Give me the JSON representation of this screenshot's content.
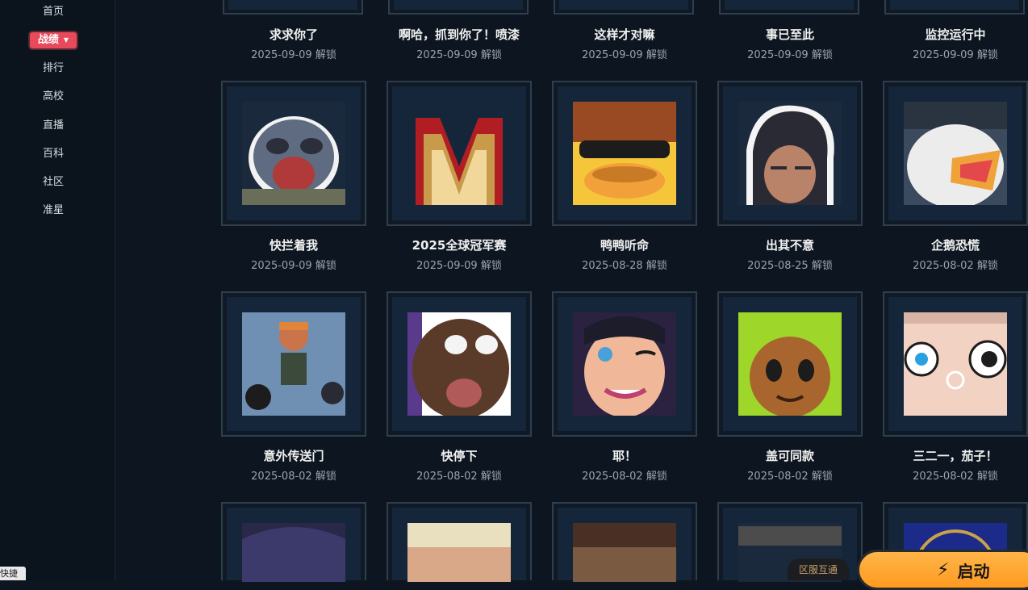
{
  "sidebar": {
    "items": [
      {
        "label": "首页"
      },
      {
        "label": "战绩",
        "active": true
      },
      {
        "label": "排行"
      },
      {
        "label": "高校"
      },
      {
        "label": "直播"
      },
      {
        "label": "百科"
      },
      {
        "label": "社区"
      },
      {
        "label": "准星"
      }
    ],
    "bottom_tag": "快捷"
  },
  "unlock_suffix": "解锁",
  "top_row": [
    {
      "title": "求求你了",
      "date": "2025-09-09 解锁"
    },
    {
      "title": "啊哈，抓到你了！喷漆",
      "date": "2025-09-09 解锁"
    },
    {
      "title": "这样才对嘛",
      "date": "2025-09-09 解锁"
    },
    {
      "title": "事已至此",
      "date": "2025-09-09 解锁"
    },
    {
      "title": "监控运行中",
      "date": "2025-09-09 解锁"
    }
  ],
  "row2": [
    {
      "title": "快拦着我",
      "date": "2025-09-09 解锁",
      "icon": "sloth-icon"
    },
    {
      "title": "2025全球冠军赛",
      "date": "2025-09-09 解锁",
      "icon": "champions-logo-icon"
    },
    {
      "title": "鸭鸭听命",
      "date": "2025-08-28 解锁",
      "icon": "duck-icon"
    },
    {
      "title": "出其不意",
      "date": "2025-08-25 解锁",
      "icon": "agent-portrait-icon"
    },
    {
      "title": "企鹅恐慌",
      "date": "2025-08-02 解锁",
      "icon": "penguin-icon"
    }
  ],
  "row3": [
    {
      "title": "意外传送门",
      "date": "2025-08-02 解锁",
      "icon": "group-agents-icon"
    },
    {
      "title": "快停下",
      "date": "2025-08-02 解锁",
      "icon": "shocked-face-icon"
    },
    {
      "title": "耶！",
      "date": "2025-08-02 解锁",
      "icon": "wink-face-icon"
    },
    {
      "title": "盖可同款",
      "date": "2025-08-02 解锁",
      "icon": "gekko-face-icon"
    },
    {
      "title": "三二一，茄子！",
      "date": "2025-08-02 解锁",
      "icon": "wide-eyes-face-icon"
    }
  ],
  "row4": [
    {
      "icon": "dark-hair-icon"
    },
    {
      "icon": "blonde-hair-icon"
    },
    {
      "icon": "bearded-face-icon"
    },
    {
      "icon": "gray-texture-icon"
    },
    {
      "icon": "blue-gold-emblem-icon"
    }
  ],
  "footer": {
    "server_badge": "区服互通",
    "launch_label": "启动"
  },
  "colors": {
    "background": "#0d1620",
    "accent_active": "#e84a5b",
    "launch": "#ff9a1f"
  }
}
